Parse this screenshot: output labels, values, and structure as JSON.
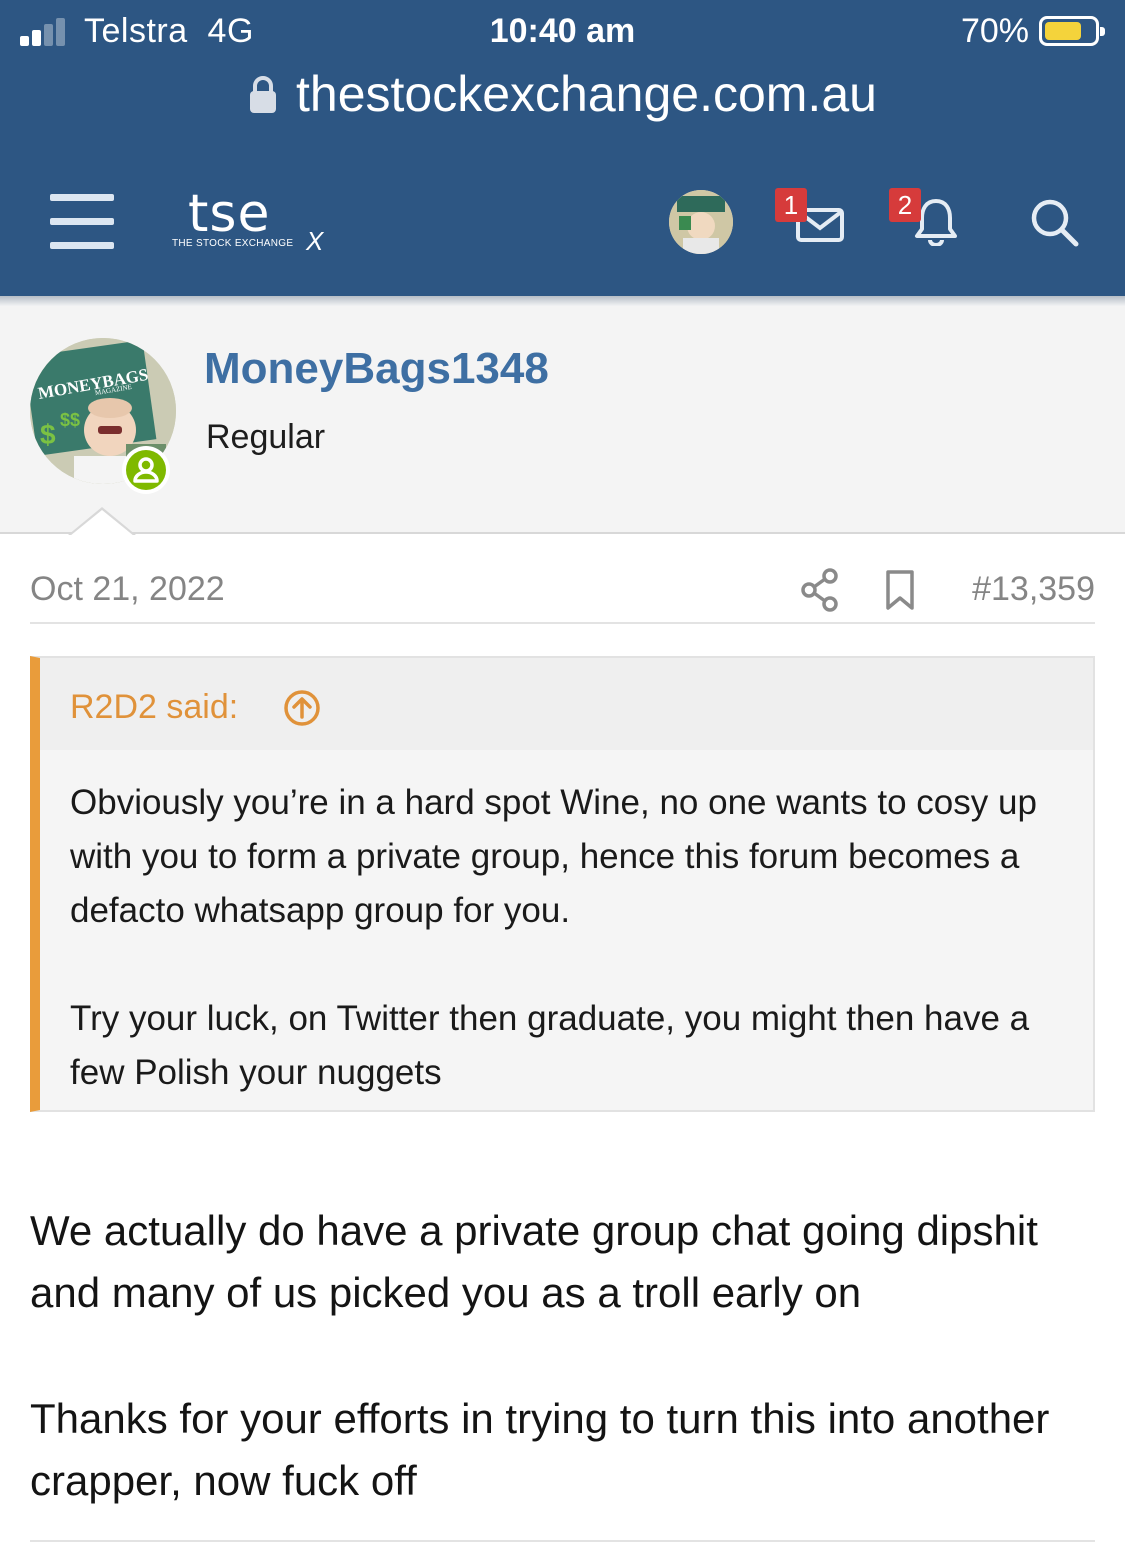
{
  "status_bar": {
    "carrier": "Telstra",
    "network": "4G",
    "time": "10:40 am",
    "battery_percent": "70%",
    "signal_bars": 2,
    "battery_level": 0.7
  },
  "browser": {
    "url": "thestockexchange.com.au",
    "lock_icon": "lock-icon"
  },
  "site_header": {
    "logo_text": "tse",
    "logo_subtitle": "THE STOCK EXCHANGE",
    "logo_mark": "X",
    "menu_icon": "hamburger-icon",
    "inbox_badge": "1",
    "alerts_badge": "2",
    "search_icon": "search-icon"
  },
  "post": {
    "author": "MoneyBags1348",
    "user_title": "Regular",
    "avatar_text": "MONEYBAGS",
    "avatar_sub": "MAGAZINE",
    "online": true,
    "date": "Oct 21, 2022",
    "post_number": "#13,359",
    "quote": {
      "author": "R2D2 said:",
      "paragraphs": [
        "Obviously you’re in a hard spot Wine, no one wants to cosy up with you to form a private group, hence this forum becomes a defacto whatsapp group for you.",
        "Try your luck, on Twitter then graduate, you might then have a few Polish your nuggets"
      ]
    },
    "body": [
      "We actually do have a private group chat going dipshit and many of us picked you as a troll early on",
      "Thanks for your efforts in trying to turn this into another crapper, now fuck off"
    ]
  },
  "colors": {
    "header_bg": "#2d5683",
    "username": "#3e6fa3",
    "quote_accent": "#e99c3b",
    "badge": "#d63b3b",
    "online": "#7fb900"
  }
}
